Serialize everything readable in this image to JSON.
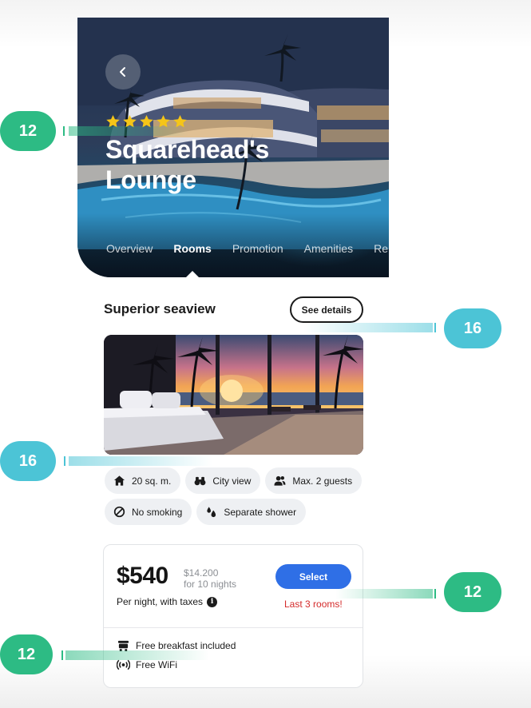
{
  "hero": {
    "back_icon": "chevron-left-icon",
    "star_count": 5,
    "star_color": "#f5c518",
    "hotel_name": "Squarehead's Lounge",
    "tabs": [
      {
        "label": "Overview",
        "active": false
      },
      {
        "label": "Rooms",
        "active": true
      },
      {
        "label": "Promotion",
        "active": false
      },
      {
        "label": "Amenities",
        "active": false
      },
      {
        "label": "Re",
        "active": false
      }
    ]
  },
  "room": {
    "title": "Superior seaview",
    "see_details_label": "See details",
    "features": [
      {
        "icon": "home-icon",
        "label": "20 sq. m."
      },
      {
        "icon": "binoculars-icon",
        "label": "City view"
      },
      {
        "icon": "guests-icon",
        "label": "Max. 2 guests"
      },
      {
        "icon": "no-smoking-icon",
        "label": "No smoking"
      },
      {
        "icon": "shower-drops-icon",
        "label": "Separate shower"
      }
    ]
  },
  "pricing": {
    "price": "$540",
    "total_price": "$14.200",
    "total_nights": "for 10 nights",
    "per_night_note": "Per night, with taxes",
    "select_label": "Select",
    "availability": "Last 3 rooms!",
    "select_color": "#2f6fe6",
    "availability_color": "#d42b2b",
    "perks": [
      {
        "icon": "breakfast-icon",
        "label": "Free breakfast included"
      },
      {
        "icon": "wifi-icon",
        "label": "Free WiFi"
      }
    ]
  },
  "annotations": [
    {
      "label": "12",
      "color": "#2dbb84"
    },
    {
      "label": "16",
      "color": "#4cc4d6"
    },
    {
      "label": "16",
      "color": "#4cc4d6"
    },
    {
      "label": "12",
      "color": "#2dbb84"
    },
    {
      "label": "12",
      "color": "#2dbb84"
    }
  ]
}
